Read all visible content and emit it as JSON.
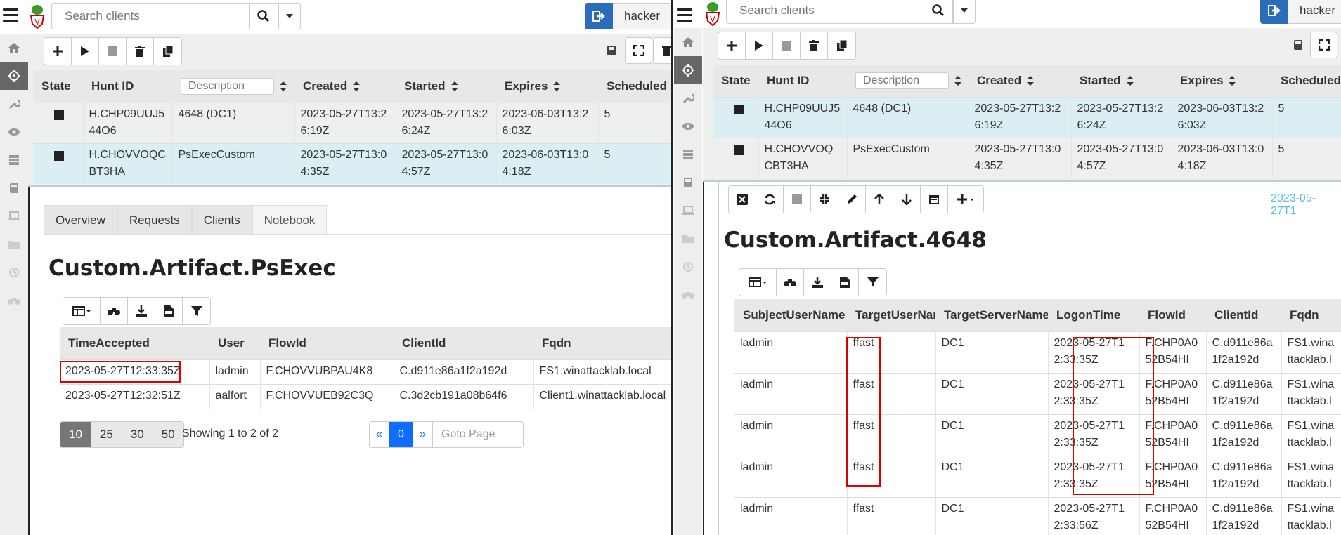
{
  "app": {
    "search_placeholder": "Search clients",
    "user": "hacker"
  },
  "hunts": {
    "columns": [
      "State",
      "Hunt ID",
      "",
      "Created",
      "Started",
      "Expires",
      "Scheduled"
    ],
    "description_placeholder": "Description",
    "rows": [
      {
        "hunt_id": "H.CHP09UUJ544O6",
        "description": "4648 (DC1)",
        "created": "2023-05-27T13:26:19Z",
        "started": "2023-05-27T13:26:24Z",
        "expires": "2023-06-03T13:26:03Z",
        "scheduled": "5"
      },
      {
        "hunt_id": "H.CHOVVOQCBT3HA",
        "description": "PsExecCustom",
        "created": "2023-05-27T13:04:35Z",
        "started": "2023-05-27T13:04:57Z",
        "expires": "2023-06-03T13:04:18Z",
        "scheduled": "5"
      }
    ]
  },
  "left": {
    "tabs": [
      "Overview",
      "Requests",
      "Clients",
      "Notebook"
    ],
    "active_tab": "Notebook",
    "heading": "Custom.Artifact.PsExec",
    "results": {
      "columns": [
        "TimeAccepted",
        "User",
        "FlowId",
        "ClientId",
        "Fqdn"
      ],
      "rows": [
        [
          "2023-05-27T12:33:35Z",
          "ladmin",
          "F.CHOVVUBPAU4K8",
          "C.d911e86a1f2a192d",
          "FS1.winattacklab.local"
        ],
        [
          "2023-05-27T12:32:51Z",
          "aalfort",
          "F.CHOVVUEB92C3Q",
          "C.3d2cb191a08b64f6",
          "Client1.winattacklab.local"
        ]
      ]
    },
    "page_sizes": [
      "10",
      "25",
      "30",
      "50"
    ],
    "showing": "Showing 1 to 2 of 2",
    "pager": {
      "prev": "«",
      "current": "0",
      "next": "»",
      "goto_placeholder": "Goto Page"
    }
  },
  "right": {
    "timestamp": "2023-05-27T1",
    "heading": "Custom.Artifact.4648",
    "results": {
      "columns": [
        "SubjectUserName",
        "TargetUserName",
        "TargetServerName",
        "LogonTime",
        "FlowId",
        "ClientId",
        "Fqdn"
      ],
      "rows": [
        [
          "ladmin",
          "ffast",
          "DC1",
          "2023-05-27T12:33:35Z",
          "F.CHP0A052B54HI",
          "C.d911e86a1f2a192d",
          "FS1.winattacklab.l"
        ],
        [
          "ladmin",
          "ffast",
          "DC1",
          "2023-05-27T12:33:35Z",
          "F.CHP0A052B54HI",
          "C.d911e86a1f2a192d",
          "FS1.winattacklab.l"
        ],
        [
          "ladmin",
          "ffast",
          "DC1",
          "2023-05-27T12:33:35Z",
          "F.CHP0A052B54HI",
          "C.d911e86a1f2a192d",
          "FS1.winattacklab.l"
        ],
        [
          "ladmin",
          "ffast",
          "DC1",
          "2023-05-27T12:33:35Z",
          "F.CHP0A052B54HI",
          "C.d911e86a1f2a192d",
          "FS1.winattacklab.l"
        ],
        [
          "ladmin",
          "ffast",
          "DC1",
          "2023-05-27T12:33:56Z",
          "F.CHP0A052B54HI",
          "C.d911e86a1f2a192d",
          "FS1.winattacklab.l"
        ]
      ]
    }
  },
  "colors": {
    "accent": "#2a6ebb",
    "highlight": "#dd0000",
    "selected_row": "#dbeef3",
    "primary": "#0d6efd"
  }
}
